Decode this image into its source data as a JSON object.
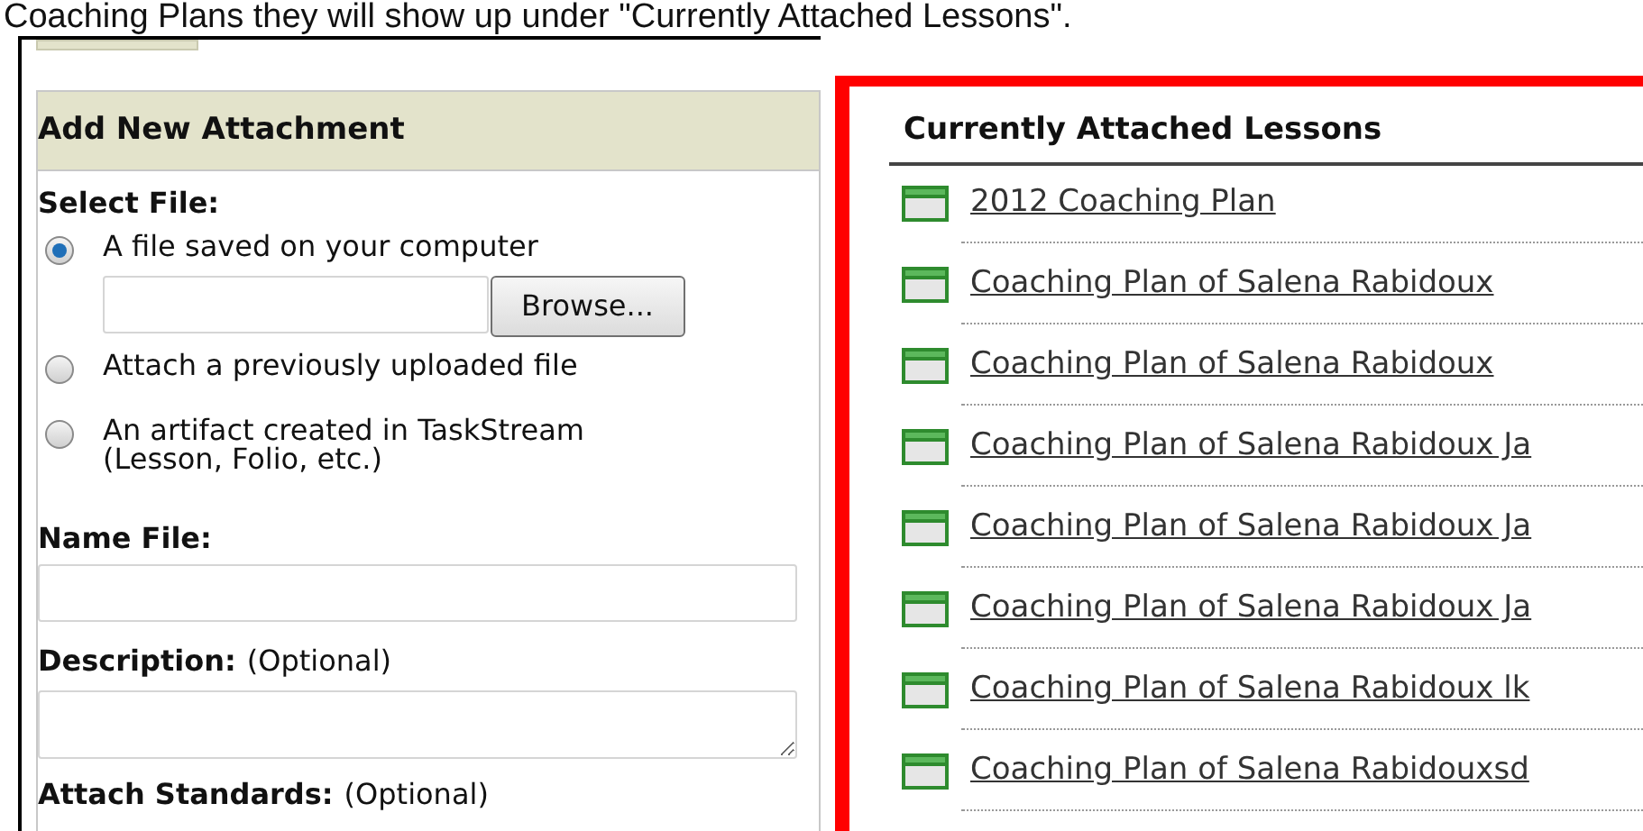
{
  "caption": "Coaching Plans they will show up under \"Currently Attached Lessons\".",
  "attachment_panel": {
    "title": "Add New Attachment",
    "select_file_label": "Select File:",
    "options": [
      {
        "label": "A file saved on your computer",
        "selected": true
      },
      {
        "label": "Attach a previously uploaded file",
        "selected": false
      },
      {
        "label": "An artifact created in TaskStream\n(Lesson, Folio, etc.)",
        "selected": false
      }
    ],
    "browse_button": "Browse...",
    "name_file_label": "Name File:",
    "description_label": "Description:",
    "description_hint": "(Optional)",
    "standards_label": "Attach Standards:",
    "standards_hint": "(Optional)"
  },
  "lessons_panel": {
    "title": "Currently Attached Lessons",
    "items": [
      "2012 Coaching Plan",
      "Coaching Plan of Salena Rabidoux",
      "Coaching Plan of Salena Rabidoux",
      "Coaching Plan of Salena Rabidoux Ja",
      "Coaching Plan of Salena Rabidoux Ja",
      "Coaching Plan of Salena Rabidoux Ja",
      "Coaching Plan of Salena Rabidoux lk",
      "Coaching Plan of Salena Rabidouxsd"
    ]
  }
}
